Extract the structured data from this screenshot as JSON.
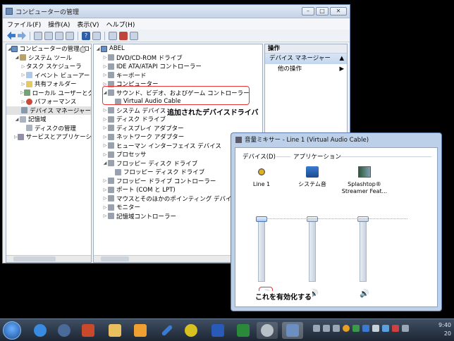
{
  "computer_management": {
    "title": "コンピューターの管理",
    "menu": [
      "ファイル(F)",
      "操作(A)",
      "表示(V)",
      "ヘルプ(H)"
    ],
    "tree": [
      {
        "label": "コンピューターの管理 (ローカ",
        "level": 0,
        "icon": "computer-icon"
      },
      {
        "label": "システム ツール",
        "level": 1,
        "icon": "tools-icon"
      },
      {
        "label": "タスク スケジューラ",
        "level": 2,
        "icon": "clock-icon"
      },
      {
        "label": "イベント ビューアー",
        "level": 2,
        "icon": "event-icon"
      },
      {
        "label": "共有フォルダー",
        "level": 2,
        "icon": "folder-icon"
      },
      {
        "label": "ローカル ユーザーとグ",
        "level": 2,
        "icon": "users-icon"
      },
      {
        "label": "パフォーマンス",
        "level": 2,
        "icon": "performance-icon"
      },
      {
        "label": "デバイス マネージャー",
        "level": 2,
        "icon": "device-manager-icon"
      },
      {
        "label": "記憶域",
        "level": 1,
        "icon": "storage-icon"
      },
      {
        "label": "ディスクの管理",
        "level": 2,
        "icon": "disk-icon"
      },
      {
        "label": "サービスとアプリケーション",
        "level": 1,
        "icon": "services-icon"
      }
    ],
    "devices_root": "ABEL",
    "devices": [
      "DVD/CD-ROM ドライブ",
      "IDE ATA/ATAPI コントローラー",
      "キーボード",
      "コンピューター",
      "サウンド、ビデオ、およびゲーム コントローラー",
      "Virtual Audio Cable",
      "システム デバイス",
      "ディスク ドライブ",
      "ディスプレイ アダプター",
      "ネットワーク アダプター",
      "ヒューマン インターフェイス デバイス",
      "プロセッサ",
      "フロッピー ディスク ドライブ",
      "フロッピー ディスク ドライブ",
      "フロッピー ドライブ コントローラー",
      "ポート (COM と LPT)",
      "マウスとそのほかのポインティング デバイス",
      "モニター",
      "記憶域コントローラー"
    ],
    "actions": {
      "header": "操作",
      "section": "デバイス マネージャー",
      "item": "他の操作"
    },
    "annotation_1": "追加されたデバイスドライバ"
  },
  "mixer": {
    "title": "音量ミキサー - Line 1 (Virtual Audio Cable)",
    "device_label": "デバイス(D)",
    "apps_label": "アプリケーション",
    "channels": [
      {
        "name": "Line 1",
        "level": 1.0
      },
      {
        "name": "システム音",
        "level": 1.0
      },
      {
        "name": "Splashtop®\nStreamer Feat...",
        "level": 1.0
      }
    ],
    "annotation_2": "これを有効化する"
  },
  "taskbar": {
    "clock_time": "9:40",
    "clock_date": "20"
  }
}
